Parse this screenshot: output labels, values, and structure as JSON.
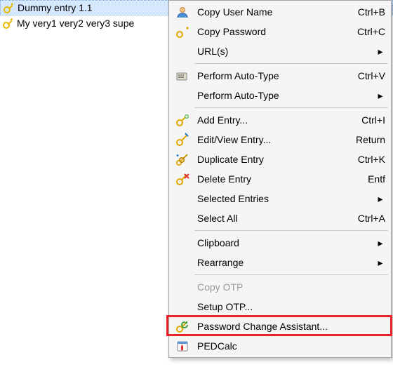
{
  "entries": [
    {
      "label": "Dummy entry 1.1",
      "selected": true
    },
    {
      "label": "My very1 very2 very3 supe",
      "selected": false
    }
  ],
  "menu": {
    "items": [
      {
        "id": "copy-user",
        "label": "Copy User Name",
        "shortcut": "Ctrl+B",
        "icon": "user-icon"
      },
      {
        "id": "copy-pass",
        "label": "Copy Password",
        "shortcut": "Ctrl+C",
        "icon": "key-gold-icon"
      },
      {
        "id": "urls",
        "label": "URL(s)",
        "submenu": true
      },
      {
        "sep": true
      },
      {
        "id": "autotype",
        "label": "Perform Auto-Type",
        "shortcut": "Ctrl+V",
        "icon": "autotype-icon"
      },
      {
        "id": "autotype2",
        "label": "Perform Auto-Type",
        "submenu": true
      },
      {
        "sep": true
      },
      {
        "id": "add-entry",
        "label": "Add Entry...",
        "shortcut": "Ctrl+I",
        "icon": "key-add-icon"
      },
      {
        "id": "edit-entry",
        "label": "Edit/View Entry...",
        "shortcut": "Return",
        "icon": "key-edit-icon"
      },
      {
        "id": "dup-entry",
        "label": "Duplicate Entry",
        "shortcut": "Ctrl+K",
        "icon": "key-dup-icon"
      },
      {
        "id": "del-entry",
        "label": "Delete Entry",
        "shortcut": "Entf",
        "icon": "key-del-icon"
      },
      {
        "id": "sel-entries",
        "label": "Selected Entries",
        "submenu": true
      },
      {
        "id": "sel-all",
        "label": "Select All",
        "shortcut": "Ctrl+A"
      },
      {
        "sep": true
      },
      {
        "id": "clipboard",
        "label": "Clipboard",
        "submenu": true
      },
      {
        "id": "rearrange",
        "label": "Rearrange",
        "submenu": true
      },
      {
        "sep": true
      },
      {
        "id": "copy-otp",
        "label": "Copy OTP",
        "disabled": true
      },
      {
        "id": "setup-otp",
        "label": "Setup OTP..."
      },
      {
        "id": "pca",
        "label": "Password Change Assistant...",
        "icon": "key-change-icon",
        "highlight": true
      },
      {
        "id": "pedcalc",
        "label": "PEDCalc",
        "icon": "calendar-icon"
      }
    ]
  }
}
